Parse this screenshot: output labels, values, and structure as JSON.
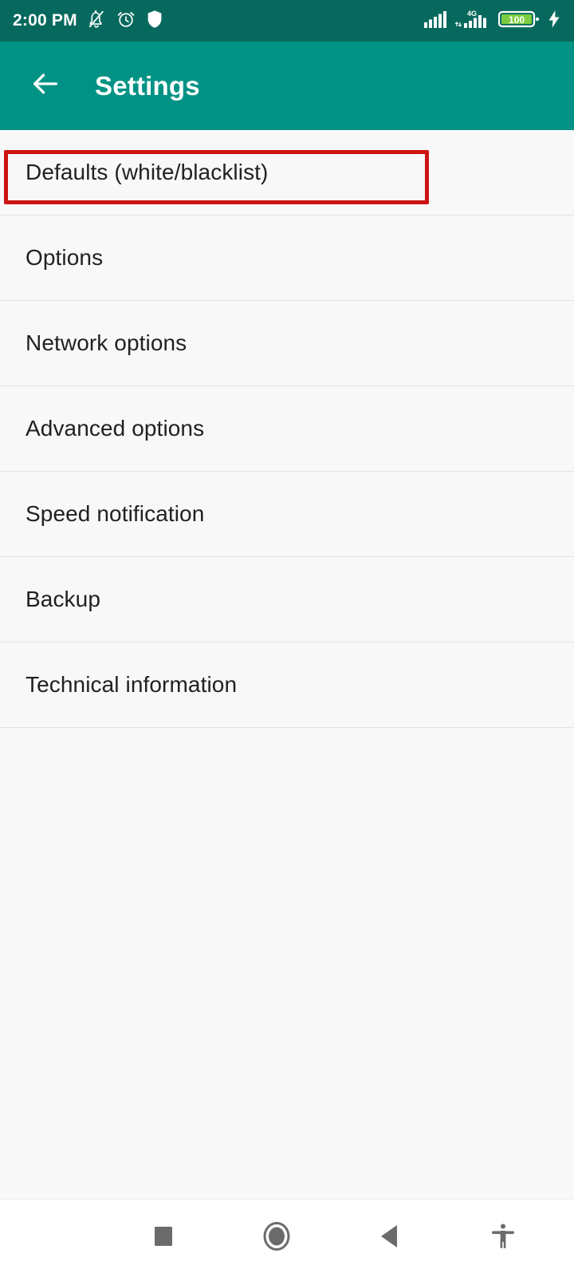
{
  "status_bar": {
    "time": "2:00 PM",
    "icons": [
      {
        "name": "notifications-off-icon",
        "label": "Notifications muted"
      },
      {
        "name": "alarm-icon",
        "label": "Alarm set"
      },
      {
        "name": "shield-icon",
        "label": "Security"
      }
    ],
    "signal_1": "signal-bars-icon",
    "network_type": "4G",
    "signal_2": "signal-bars-4g-icon",
    "battery_level": "100",
    "battery_charging": "charging-bolt-icon",
    "background_color": "#07695D",
    "foreground_color": "#FFFFFF",
    "battery_fill_color": "#7CCC3F"
  },
  "app_bar": {
    "back_icon": "arrow-back-icon",
    "title": "Settings",
    "background_color": "#009385",
    "title_color": "#FFFFFF"
  },
  "settings_list": {
    "background_color": "#F8F8F8",
    "divider_color": "#E2E2E2",
    "text_color": "#212121",
    "items": [
      {
        "label": "Defaults (white/blacklist)",
        "highlighted": true
      },
      {
        "label": "Options",
        "highlighted": false
      },
      {
        "label": "Network options",
        "highlighted": false
      },
      {
        "label": "Advanced options",
        "highlighted": false
      },
      {
        "label": "Speed notification",
        "highlighted": false
      },
      {
        "label": "Backup",
        "highlighted": false
      },
      {
        "label": "Technical information",
        "highlighted": false
      }
    ]
  },
  "highlight": {
    "color": "#CC1414",
    "target": "Defaults (white/blacklist)"
  },
  "nav_bar": {
    "background_color": "#FFFFFF",
    "icon_color": "#6B6B6B",
    "buttons": [
      {
        "name": "recents-button",
        "icon": "square-icon"
      },
      {
        "name": "home-button",
        "icon": "circle-icon"
      },
      {
        "name": "back-button",
        "icon": "triangle-left-icon"
      },
      {
        "name": "accessibility-button",
        "icon": "accessibility-person-icon"
      }
    ]
  }
}
